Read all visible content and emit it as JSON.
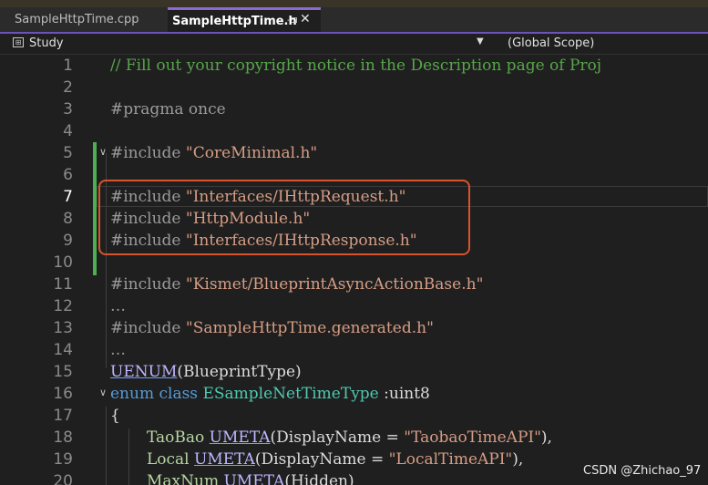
{
  "tabs": {
    "inactive_label": "SampleHttpTime.cpp",
    "active_label": "SampleHttpTime.h",
    "pin_symbol": "-⊐",
    "close_symbol": "✕"
  },
  "navbar": {
    "project": "Study",
    "scope": "(Global Scope)"
  },
  "editor": {
    "current_line": 7,
    "lines": [
      {
        "n": "1"
      },
      {
        "n": "2"
      },
      {
        "n": "3"
      },
      {
        "n": "4"
      },
      {
        "n": "5"
      },
      {
        "n": "6"
      },
      {
        "n": "7"
      },
      {
        "n": "8"
      },
      {
        "n": "9"
      },
      {
        "n": "10"
      },
      {
        "n": "11"
      },
      {
        "n": "12"
      },
      {
        "n": "13"
      },
      {
        "n": "14"
      },
      {
        "n": "15"
      },
      {
        "n": "16"
      },
      {
        "n": "17"
      },
      {
        "n": "18"
      },
      {
        "n": "19"
      },
      {
        "n": "20"
      }
    ],
    "code": {
      "l1_comment": "// Fill out your copyright notice in the Description page of Proj",
      "l3_pragma": "#pragma once",
      "l5_dir": "#include ",
      "l5_str": "\"CoreMinimal.h\"",
      "l7_dir": "#include ",
      "l7_str": "\"Interfaces/IHttpRequest.h\"",
      "l8_dir": "#include ",
      "l8_str": "\"HttpModule.h\"",
      "l9_dir": "#include ",
      "l9_str": "\"Interfaces/IHttpResponse.h\"",
      "l11_dir": "#include ",
      "l11_str": "\"Kismet/BlueprintAsyncActionBase.h\"",
      "l12_dots": "…",
      "l13_dir": "#include ",
      "l13_str": "\"SampleHttpTime.generated.h\"",
      "l14_dots": "…",
      "l15_macro": "UENUM",
      "l15_rest": "(BlueprintType)",
      "l16_kw": "enum class ",
      "l16_type": "ESampleNetTimeType",
      "l16_rest": " :uint8",
      "l17_brace": "{",
      "l18_name": "TaoBao",
      "l18_macro": "UMETA",
      "l18_mid": "(DisplayName = ",
      "l18_str": "\"TaobaoTimeAPI\"",
      "l18_end": "),",
      "l19_name": "Local",
      "l19_macro": "UMETA",
      "l19_mid": "(DisplayName = ",
      "l19_str": "\"LocalTimeAPI\"",
      "l19_end": "),",
      "l20_name": "MaxNum",
      "l20_macro": "UMETA",
      "l20_rest": "(Hidden)"
    }
  },
  "watermark": "CSDN @Zhichao_97",
  "colors": {
    "comment": "#57a64a",
    "string": "#d69d85",
    "keyword": "#569cd6",
    "macro": "#beb7ff",
    "type": "#4ec9b0",
    "highlight_box": "#d9532c",
    "change_bar": "#4caf50",
    "active_tab_accent": "#8b6ad8"
  }
}
